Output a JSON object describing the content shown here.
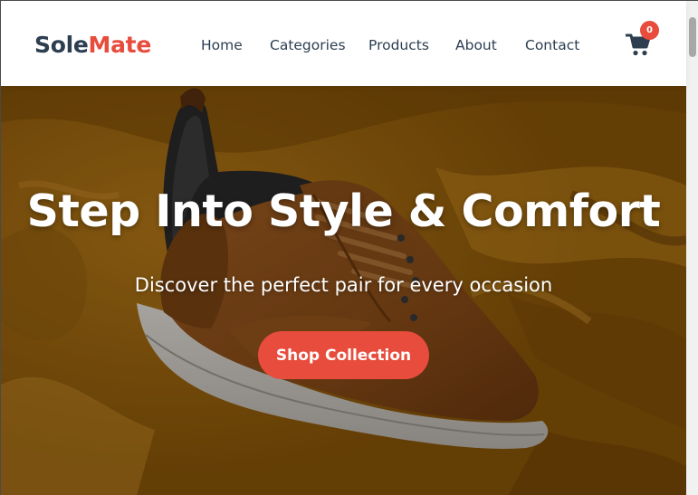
{
  "brand": {
    "part1": "Sole",
    "part2": "Mate"
  },
  "nav": {
    "items": [
      {
        "label": "Home"
      },
      {
        "label": "Categories"
      },
      {
        "label": "Products"
      },
      {
        "label": "About"
      },
      {
        "label": "Contact"
      }
    ]
  },
  "cart": {
    "icon": "shopping-cart-icon",
    "count": "0"
  },
  "hero": {
    "title": "Step Into Style & Comfort",
    "subtitle": "Discover the perfect pair for every occasion",
    "cta_label": "Shop Collection",
    "image": "brown-sneaker-on-mustard-corduroy"
  },
  "colors": {
    "brand_dark": "#2c3e50",
    "accent": "#e74c3c",
    "hero_backdrop": "#a06810"
  }
}
